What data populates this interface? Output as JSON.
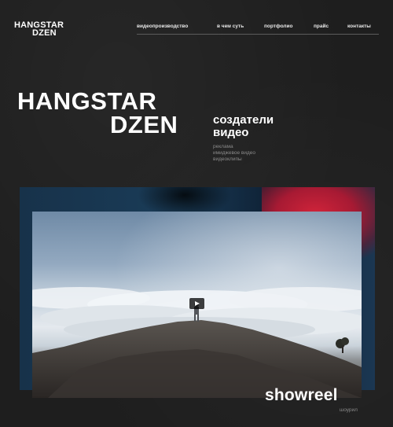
{
  "logo": {
    "line1": "HANGSTAR",
    "line2": "DZEN"
  },
  "nav": {
    "items": [
      {
        "label": "видеопроизводство"
      },
      {
        "label": "в чем суть"
      },
      {
        "label": "портфолио"
      },
      {
        "label": "прайс"
      },
      {
        "label": "контакты"
      }
    ]
  },
  "hero": {
    "title_line1": "HANGSTAR",
    "title_line2": "DZEN",
    "tagline_line1": "создатели",
    "tagline_line2": "видео",
    "services": [
      "реклама",
      "имиджевое видео",
      "видеоклипы"
    ]
  },
  "video": {
    "title": "showreel",
    "subtitle": "шоурил"
  },
  "colors": {
    "background": "#1e1e1e",
    "text": "#ffffff",
    "muted": "#8a8a8a",
    "frame_blue": "#1a3c58",
    "accent_red": "#d0243a"
  },
  "icons": {
    "play": "play-icon"
  }
}
